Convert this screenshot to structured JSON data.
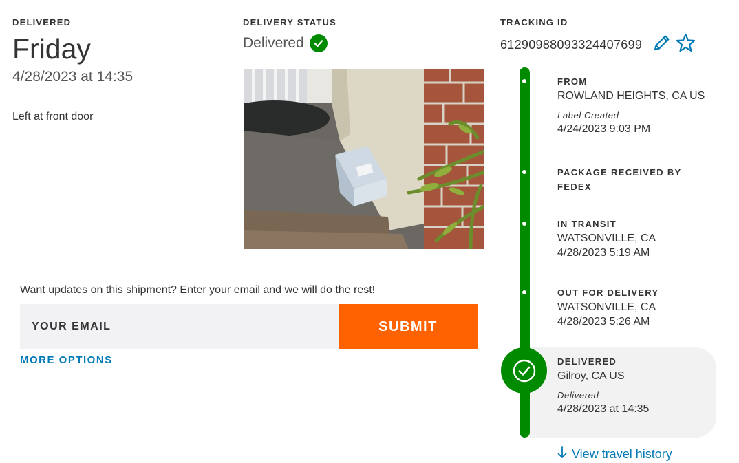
{
  "delivered": {
    "eyebrow": "DELIVERED",
    "day": "Friday",
    "datetime": "4/28/2023 at 14:35",
    "note": "Left at front door"
  },
  "status": {
    "label": "DELIVERY STATUS",
    "value": "Delivered",
    "icon": "check-circle-icon",
    "color": "#008a00"
  },
  "photo": {
    "alt": "Package left at front door"
  },
  "email": {
    "prompt": "Want updates on this shipment? Enter your email and we will do the rest!",
    "placeholder": "YOUR EMAIL",
    "value": "",
    "submit_label": "SUBMIT",
    "more_options": "MORE OPTIONS",
    "submit_color": "#ff6200"
  },
  "tracking": {
    "label": "TRACKING ID",
    "number": "61290988093324407699",
    "edit_icon": "pencil-icon",
    "favorite_icon": "star-outline-icon"
  },
  "timeline": {
    "color": "#008a00",
    "events": [
      {
        "title": "FROM",
        "location": "ROWLAND HEIGHTS, CA US",
        "note": "Label Created",
        "time": "4/24/2023 9:03 PM"
      },
      {
        "title": "PACKAGE RECEIVED BY FEDEX",
        "location": "",
        "note": "",
        "time": ""
      },
      {
        "title": "IN TRANSIT",
        "location": "WATSONVILLE, CA",
        "note": "",
        "time": "4/28/2023 5:19 AM"
      },
      {
        "title": "OUT FOR DELIVERY",
        "location": "WATSONVILLE, CA",
        "note": "",
        "time": "4/28/2023 5:26 AM"
      },
      {
        "title": "DELIVERED",
        "location": "Gilroy, CA US",
        "note": "Delivered",
        "time": "4/28/2023 at 14:35"
      }
    ],
    "view_history": "View travel history",
    "view_history_icon": "arrow-down-icon"
  },
  "colors": {
    "link": "#007ab7",
    "text": "#333333"
  }
}
